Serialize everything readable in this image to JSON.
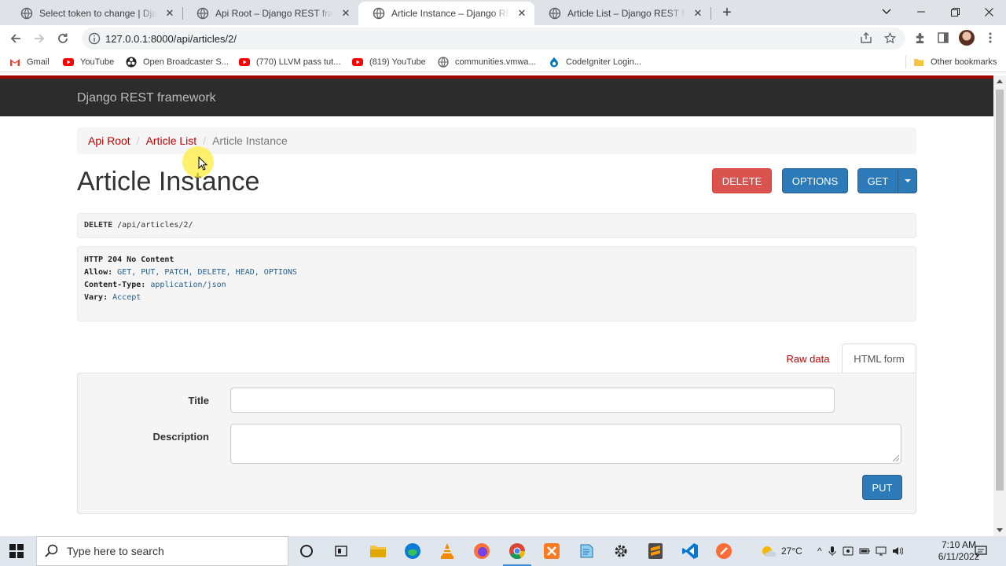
{
  "browser": {
    "tabs": [
      {
        "title": "Select token to change | Django",
        "icon": "globe-icon",
        "active": false
      },
      {
        "title": "Api Root – Django REST framework",
        "icon": "globe-icon",
        "active": false
      },
      {
        "title": "Article Instance – Django REST fr...",
        "icon": "globe-icon",
        "active": true
      },
      {
        "title": "Article List – Django REST framew...",
        "icon": "globe-icon",
        "active": false
      }
    ],
    "url": "127.0.0.1:8000/api/articles/2/",
    "bookmarks": [
      {
        "label": "Gmail",
        "icon": "gmail-icon"
      },
      {
        "label": "YouTube",
        "icon": "youtube-icon"
      },
      {
        "label": "Open Broadcaster S...",
        "icon": "obs-icon"
      },
      {
        "label": "(770) LLVM pass tut...",
        "icon": "youtube-icon"
      },
      {
        "label": "(819) YouTube",
        "icon": "youtube-icon"
      },
      {
        "label": "communities.vmwa...",
        "icon": "globe-icon"
      },
      {
        "label": "CodeIgniter Login...",
        "icon": "drupal-icon"
      }
    ],
    "other_bookmarks": "Other bookmarks"
  },
  "page": {
    "brand": "Django REST framework",
    "breadcrumb": {
      "root": "Api Root",
      "list": "Article List",
      "current": "Article Instance"
    },
    "title": "Article Instance",
    "buttons": {
      "delete": "DELETE",
      "options": "OPTIONS",
      "get": "GET",
      "put": "PUT"
    },
    "request": {
      "method": "DELETE",
      "path": "/api/articles/2/"
    },
    "response": {
      "status": "HTTP 204 No Content",
      "allow_key": "Allow:",
      "allow": "GET, PUT, PATCH, DELETE, HEAD, OPTIONS",
      "content_type_key": "Content-Type:",
      "content_type": "application/json",
      "vary_key": "Vary:",
      "vary": "Accept"
    },
    "tabs": {
      "raw": "Raw data",
      "html": "HTML form"
    },
    "form": {
      "title_label": "Title",
      "title_value": "",
      "description_label": "Description",
      "description_value": ""
    }
  },
  "taskbar": {
    "search_placeholder": "Type here to search",
    "temperature": "27°C",
    "time": "7:10 AM",
    "date": "6/11/2022"
  },
  "colors": {
    "drf_navbar": "#2c2c2c",
    "drf_accent": "#a30000",
    "link": "#c20000",
    "delete": "#d9534f",
    "primary": "#2c7ab8"
  }
}
